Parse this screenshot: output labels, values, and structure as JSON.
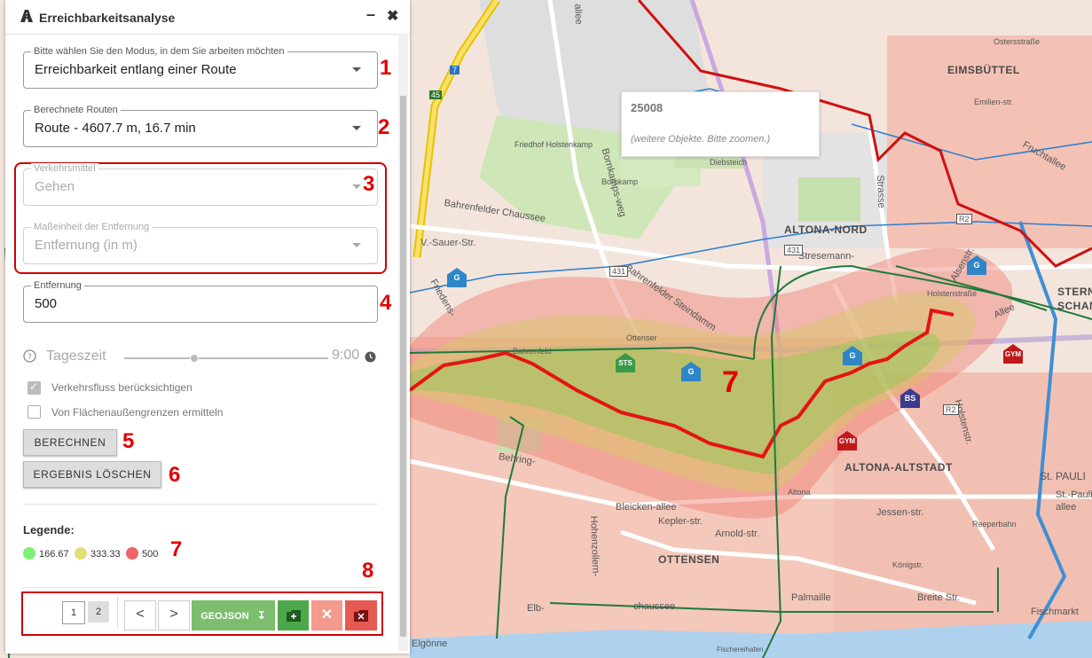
{
  "panel": {
    "title": "Erreichbarkeitsanalyse",
    "minimize_label": "–",
    "close_label": "✖"
  },
  "mode_select": {
    "label": "Bitte wählen Sie den Modus, in dem Sie arbeiten möchten",
    "value": "Erreichbarkeit entlang einer Route"
  },
  "routes_select": {
    "label": "Berechnete Routen",
    "value": "Route - 4607.7 m, 16.7 min"
  },
  "transport_select": {
    "label": "Verkehrsmittel",
    "value": "Gehen"
  },
  "unit_select": {
    "label": "Maßeinheit der Entfernung",
    "value": "Entfernung (in m)"
  },
  "distance_input": {
    "label": "Entfernung",
    "value": "500"
  },
  "time_of_day": {
    "label": "Tageszeit",
    "value": "9:00"
  },
  "checkboxes": {
    "traffic_flow": "Verkehrsfluss berücksichtigen",
    "area_borders": "Von Flächenaußengrenzen ermitteln"
  },
  "buttons": {
    "calculate": "BERECHNEN",
    "clear": "ERGEBNIS LÖSCHEN"
  },
  "legend": {
    "title": "Legende:",
    "items": [
      {
        "value": "166.67",
        "color": "#7ef07a"
      },
      {
        "value": "333.33",
        "color": "#e1e078"
      },
      {
        "value": "500",
        "color": "#f06565"
      }
    ]
  },
  "toolbar": {
    "pages": [
      "1",
      "2"
    ],
    "prev": "<",
    "next": ">",
    "geojson": "GEOJSON"
  },
  "annotations": [
    "1",
    "2",
    "3",
    "4",
    "5",
    "6",
    "7",
    "8",
    "7"
  ],
  "map": {
    "tooltip": {
      "title": "25008",
      "hint": "(weitere Objekte. Bitte zoomen.)"
    },
    "districts": [
      "EIMSBÜTTEL",
      "ALTONA-NORD",
      "ALTONA-ALTSTADT",
      "OTTENSEN",
      "STERN",
      "SCHAN",
      "St. PAULI"
    ],
    "streets": [
      "Bahrenfelder Chaussee",
      "Stresemann-",
      "Bornkamps-weg",
      "Bahrenfelder Steindamm",
      "V.-Sauer-Str.",
      "Friedens-",
      "Bahrenfeld",
      "Diebsteich",
      "Holstenstraße",
      "Alsenstr.",
      "Allee",
      "Friedhof Holstenkamp",
      "Bornkamp",
      "Ottenser",
      "Behring-",
      "Bleicken-allee",
      "Kepler-str.",
      "Arnold-str.",
      "Elb-",
      "chaussee",
      "Palmaille",
      "Breite Str.",
      "Königstr.",
      "Reeperbahn",
      "Jessen-str.",
      "Holstenstr.",
      "Fischmarkt",
      "Altona",
      "Hohenzollern-",
      "allee",
      "Strasse",
      "Elgönne",
      "Ostersstraße",
      "Emilien-str.",
      "Fruchtallee",
      "St.-Pauli-",
      "allee",
      "Fischereihafen"
    ],
    "poi": [
      "G",
      "G",
      "G",
      "G",
      "STS",
      "BS",
      "GYM",
      "GYM",
      "R2",
      "R2",
      "431",
      "431",
      "45",
      "7"
    ]
  }
}
